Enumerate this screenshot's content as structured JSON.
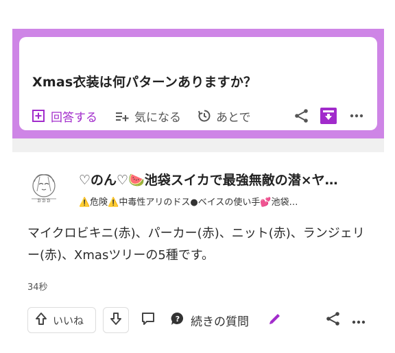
{
  "question": {
    "title": "Xmas衣装は何パターンありますか？",
    "actions": {
      "answer_label": "回答する",
      "curious_label": "気になる",
      "later_label": "あとで"
    }
  },
  "answer": {
    "author_name": "♡のん♡🍉池袋スイカで最強無敵の潜×ヤ…",
    "author_bio": "⚠️危険⚠️中毒性アリのドス●ベイスの使い手💕池袋…",
    "body": "マイクロビキニ(赤)、パーカー(赤)、ニット(赤)、ランジェリー(赤)、Xmasツリーの5種です。",
    "timestamp": "34秒",
    "actions": {
      "like_label": "いいね",
      "continue_label": "続きの質問"
    }
  },
  "colors": {
    "accent_purple": "#a12bcb",
    "frame_purple": "#ce85e6",
    "band_gray": "#f0f0f0"
  },
  "icons": [
    "add-answer-icon",
    "follow-list-icon",
    "later-clock-icon",
    "share-icon",
    "archive-icon",
    "more-icon",
    "upvote-icon",
    "downvote-icon",
    "comment-icon",
    "question-bubble-icon",
    "pencil-icon"
  ]
}
